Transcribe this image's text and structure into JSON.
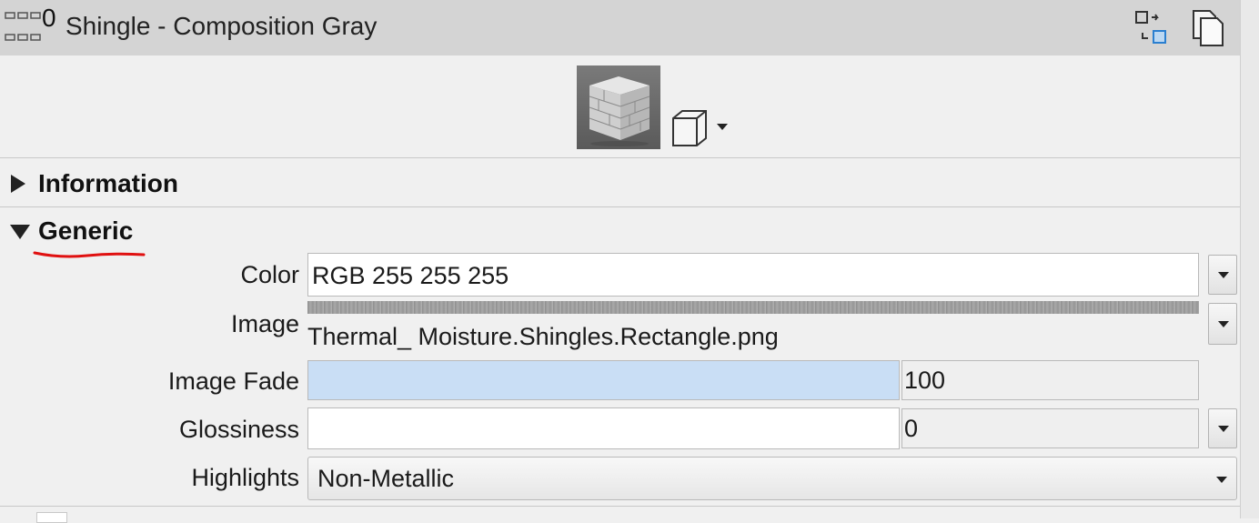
{
  "header": {
    "usage_count": "0",
    "title": "Shingle - Composition Gray"
  },
  "sections": {
    "information": {
      "label": "Information",
      "expanded": false
    },
    "generic": {
      "label": "Generic",
      "expanded": true
    }
  },
  "generic": {
    "color": {
      "label": "Color",
      "value": "RGB 255 255 255"
    },
    "image": {
      "label": "Image",
      "file": "Thermal_ Moisture.Shingles.Rectangle.png"
    },
    "image_fade": {
      "label": "Image Fade",
      "value": "100",
      "level_percent": 100
    },
    "glossiness": {
      "label": "Glossiness",
      "value": "0",
      "level_percent": 0
    },
    "highlights": {
      "label": "Highlights",
      "value": "Non-Metallic"
    }
  },
  "colors": {
    "header_bg": "#d4d4d4",
    "panel_bg": "#f0f0f0",
    "slider_fill": "#c9def5",
    "annotation_underline": "#e01010"
  }
}
